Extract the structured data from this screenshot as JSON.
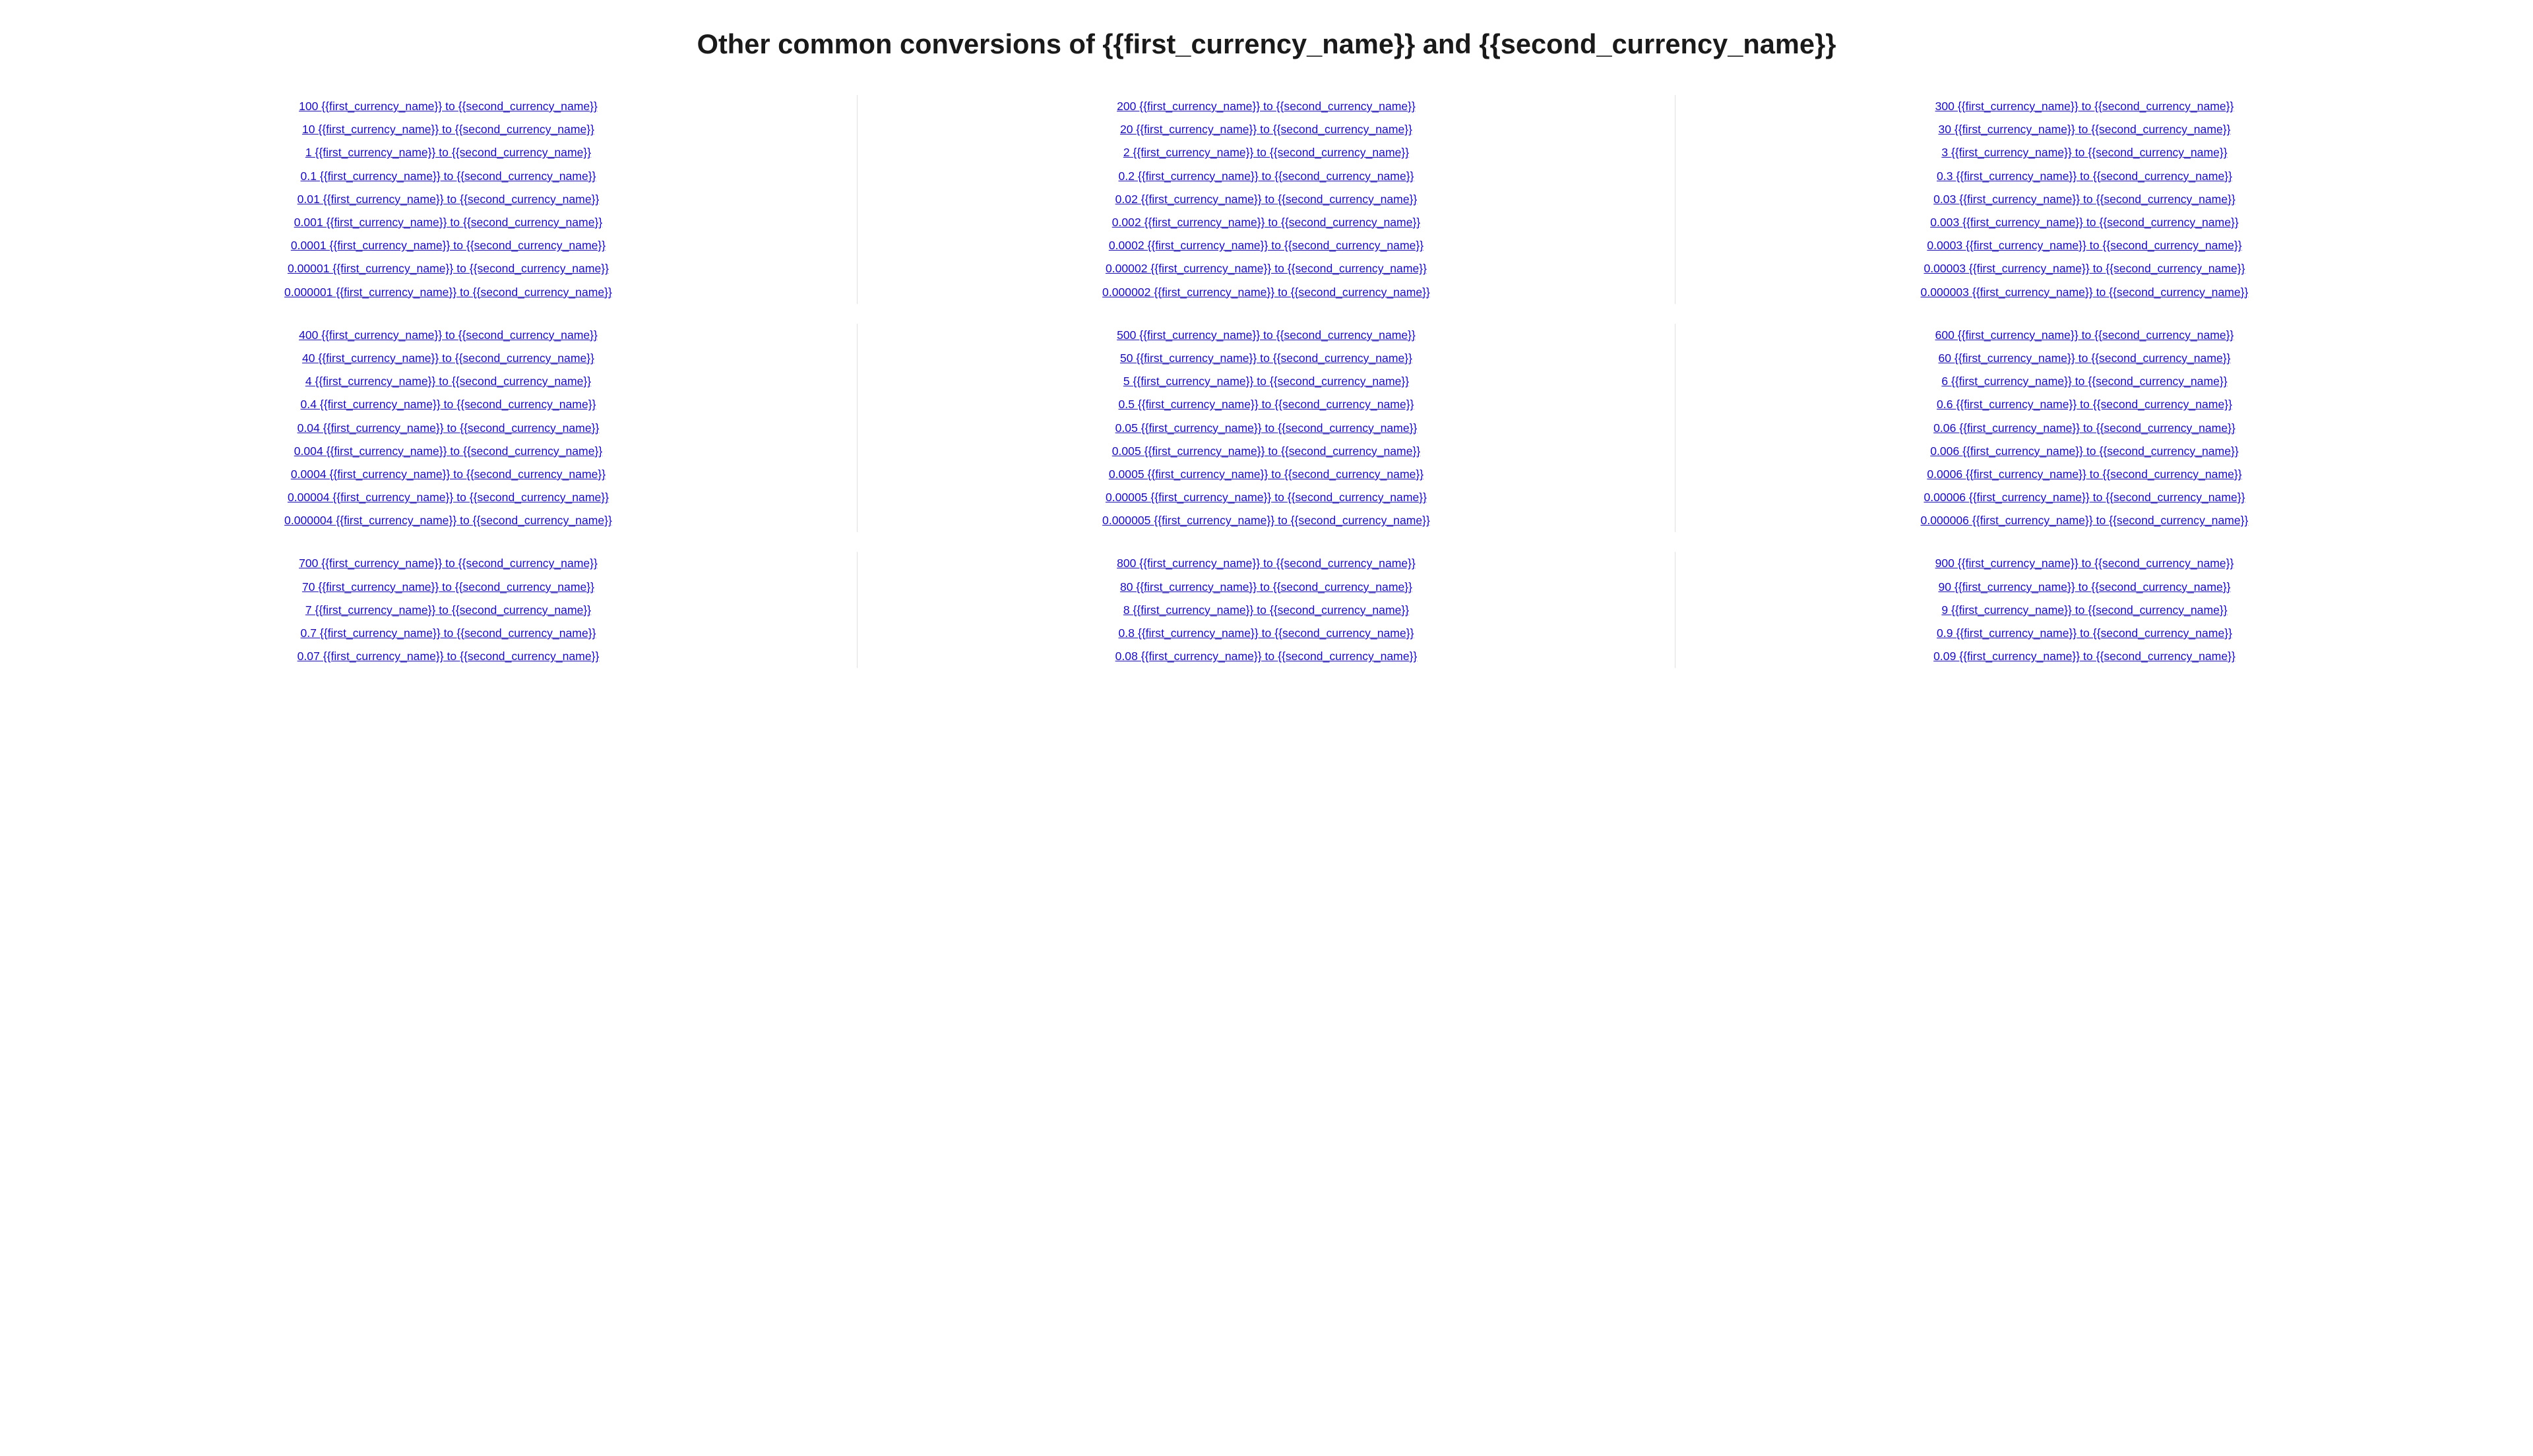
{
  "page": {
    "title": "Other common conversions of {{first_currency_name}} and {{second_currency_name}}"
  },
  "groups": [
    {
      "columns": [
        {
          "links": [
            "100 {{first_currency_name}} to {{second_currency_name}}",
            "10 {{first_currency_name}} to {{second_currency_name}}",
            "1 {{first_currency_name}} to {{second_currency_name}}",
            "0.1 {{first_currency_name}} to {{second_currency_name}}",
            "0.01 {{first_currency_name}} to {{second_currency_name}}",
            "0.001 {{first_currency_name}} to {{second_currency_name}}",
            "0.0001 {{first_currency_name}} to {{second_currency_name}}",
            "0.00001 {{first_currency_name}} to {{second_currency_name}}",
            "0.000001 {{first_currency_name}} to {{second_currency_name}}"
          ]
        },
        {
          "links": [
            "200 {{first_currency_name}} to {{second_currency_name}}",
            "20 {{first_currency_name}} to {{second_currency_name}}",
            "2 {{first_currency_name}} to {{second_currency_name}}",
            "0.2 {{first_currency_name}} to {{second_currency_name}}",
            "0.02 {{first_currency_name}} to {{second_currency_name}}",
            "0.002 {{first_currency_name}} to {{second_currency_name}}",
            "0.0002 {{first_currency_name}} to {{second_currency_name}}",
            "0.00002 {{first_currency_name}} to {{second_currency_name}}",
            "0.000002 {{first_currency_name}} to {{second_currency_name}}"
          ]
        },
        {
          "links": [
            "300 {{first_currency_name}} to {{second_currency_name}}",
            "30 {{first_currency_name}} to {{second_currency_name}}",
            "3 {{first_currency_name}} to {{second_currency_name}}",
            "0.3 {{first_currency_name}} to {{second_currency_name}}",
            "0.03 {{first_currency_name}} to {{second_currency_name}}",
            "0.003 {{first_currency_name}} to {{second_currency_name}}",
            "0.0003 {{first_currency_name}} to {{second_currency_name}}",
            "0.00003 {{first_currency_name}} to {{second_currency_name}}",
            "0.000003 {{first_currency_name}} to {{second_currency_name}}"
          ]
        }
      ]
    },
    {
      "columns": [
        {
          "links": [
            "400 {{first_currency_name}} to {{second_currency_name}}",
            "40 {{first_currency_name}} to {{second_currency_name}}",
            "4 {{first_currency_name}} to {{second_currency_name}}",
            "0.4 {{first_currency_name}} to {{second_currency_name}}",
            "0.04 {{first_currency_name}} to {{second_currency_name}}",
            "0.004 {{first_currency_name}} to {{second_currency_name}}",
            "0.0004 {{first_currency_name}} to {{second_currency_name}}",
            "0.00004 {{first_currency_name}} to {{second_currency_name}}",
            "0.000004 {{first_currency_name}} to {{second_currency_name}}"
          ]
        },
        {
          "links": [
            "500 {{first_currency_name}} to {{second_currency_name}}",
            "50 {{first_currency_name}} to {{second_currency_name}}",
            "5 {{first_currency_name}} to {{second_currency_name}}",
            "0.5 {{first_currency_name}} to {{second_currency_name}}",
            "0.05 {{first_currency_name}} to {{second_currency_name}}",
            "0.005 {{first_currency_name}} to {{second_currency_name}}",
            "0.0005 {{first_currency_name}} to {{second_currency_name}}",
            "0.00005 {{first_currency_name}} to {{second_currency_name}}",
            "0.000005 {{first_currency_name}} to {{second_currency_name}}"
          ]
        },
        {
          "links": [
            "600 {{first_currency_name}} to {{second_currency_name}}",
            "60 {{first_currency_name}} to {{second_currency_name}}",
            "6 {{first_currency_name}} to {{second_currency_name}}",
            "0.6 {{first_currency_name}} to {{second_currency_name}}",
            "0.06 {{first_currency_name}} to {{second_currency_name}}",
            "0.006 {{first_currency_name}} to {{second_currency_name}}",
            "0.0006 {{first_currency_name}} to {{second_currency_name}}",
            "0.00006 {{first_currency_name}} to {{second_currency_name}}",
            "0.000006 {{first_currency_name}} to {{second_currency_name}}"
          ]
        }
      ]
    },
    {
      "columns": [
        {
          "links": [
            "700 {{first_currency_name}} to {{second_currency_name}}",
            "70 {{first_currency_name}} to {{second_currency_name}}",
            "7 {{first_currency_name}} to {{second_currency_name}}",
            "0.7 {{first_currency_name}} to {{second_currency_name}}",
            "0.07 {{first_currency_name}} to {{second_currency_name}}"
          ]
        },
        {
          "links": [
            "800 {{first_currency_name}} to {{second_currency_name}}",
            "80 {{first_currency_name}} to {{second_currency_name}}",
            "8 {{first_currency_name}} to {{second_currency_name}}",
            "0.8 {{first_currency_name}} to {{second_currency_name}}",
            "0.08 {{first_currency_name}} to {{second_currency_name}}"
          ]
        },
        {
          "links": [
            "900 {{first_currency_name}} to {{second_currency_name}}",
            "90 {{first_currency_name}} to {{second_currency_name}}",
            "9 {{first_currency_name}} to {{second_currency_name}}",
            "0.9 {{first_currency_name}} to {{second_currency_name}}",
            "0.09 {{first_currency_name}} to {{second_currency_name}}"
          ]
        }
      ]
    }
  ]
}
